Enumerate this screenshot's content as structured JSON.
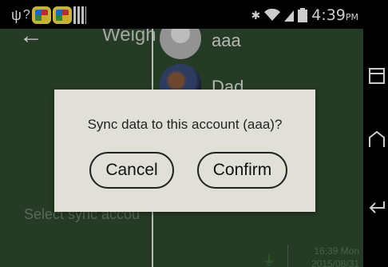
{
  "status_bar": {
    "time": "4:39",
    "ampm": "PM"
  },
  "header": {
    "weight_label": "Weigh"
  },
  "accounts": [
    {
      "name": "aaa"
    },
    {
      "name": "Dad"
    }
  ],
  "footer": {
    "select_label": "Select sync accou",
    "time": "16:39 Mon",
    "date": "2015/08/31"
  },
  "dialog": {
    "message": "Sync data to this account (aaa)?",
    "cancel_label": "Cancel",
    "confirm_label": "Confirm"
  },
  "colors": {
    "app_background": "#2f4a2f",
    "dialog_background": "#e1e0d8"
  },
  "icons": {
    "usb": "usb-icon",
    "help": "help-icon",
    "wifi": "wifi-icon",
    "bluetooth": "bluetooth-icon",
    "battery": "battery-icon",
    "back": "back-arrow-icon",
    "plug": "plug-icon",
    "nav_recents": "recent-apps-icon",
    "nav_home": "home-icon",
    "nav_back": "nav-back-icon"
  }
}
